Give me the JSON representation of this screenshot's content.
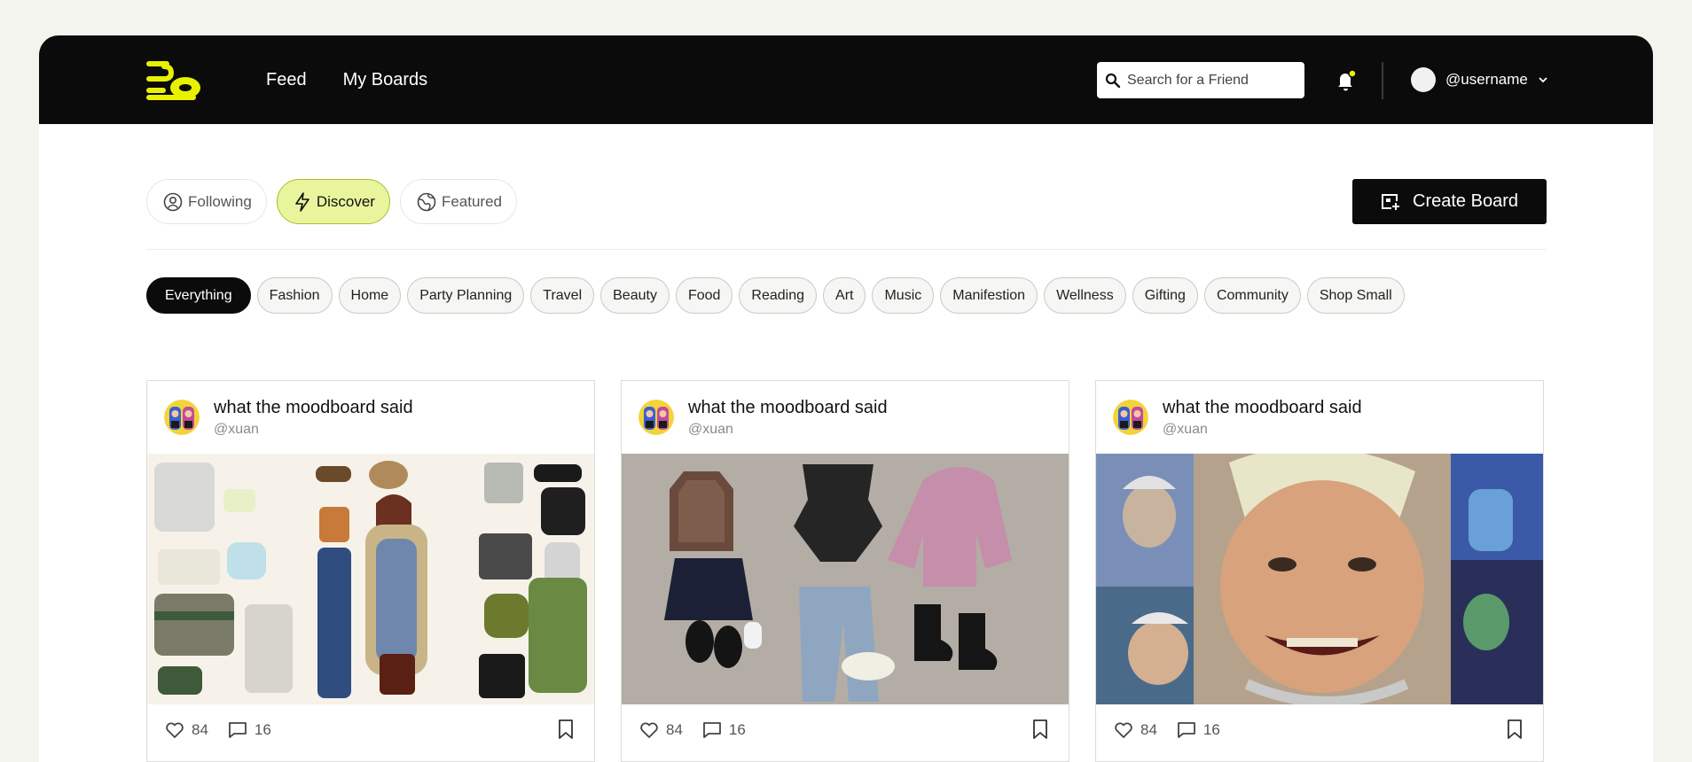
{
  "header": {
    "nav": [
      {
        "label": "Feed"
      },
      {
        "label": "My Boards"
      }
    ],
    "search": {
      "placeholder": "Search for a Friend"
    },
    "user": {
      "username": "@username"
    },
    "colors": {
      "bar": "#0b0b0b",
      "accent": "#e8f200"
    }
  },
  "modes": [
    {
      "label": "Following",
      "icon": "user-circle-icon",
      "active": false
    },
    {
      "label": "Discover",
      "icon": "lightning-icon",
      "active": true
    },
    {
      "label": "Featured",
      "icon": "globe-icon",
      "active": false
    }
  ],
  "create_board": {
    "label": "Create Board",
    "icon": "add-board-icon"
  },
  "categories": [
    {
      "label": "Everything",
      "active": true
    },
    {
      "label": "Fashion"
    },
    {
      "label": "Home"
    },
    {
      "label": "Party Planning"
    },
    {
      "label": "Travel"
    },
    {
      "label": "Beauty"
    },
    {
      "label": "Food"
    },
    {
      "label": "Reading"
    },
    {
      "label": "Art"
    },
    {
      "label": "Music"
    },
    {
      "label": "Manifestion"
    },
    {
      "label": "Wellness"
    },
    {
      "label": "Gifting"
    },
    {
      "label": "Community"
    },
    {
      "label": "Shop Small"
    }
  ],
  "cards": [
    {
      "title": "what the moodboard said",
      "handle": "@xuan",
      "likes": "84",
      "comments": "16"
    },
    {
      "title": "what the moodboard said",
      "handle": "@xuan",
      "likes": "84",
      "comments": "16"
    },
    {
      "title": "what the moodboard said",
      "handle": "@xuan",
      "likes": "84",
      "comments": "16"
    }
  ]
}
